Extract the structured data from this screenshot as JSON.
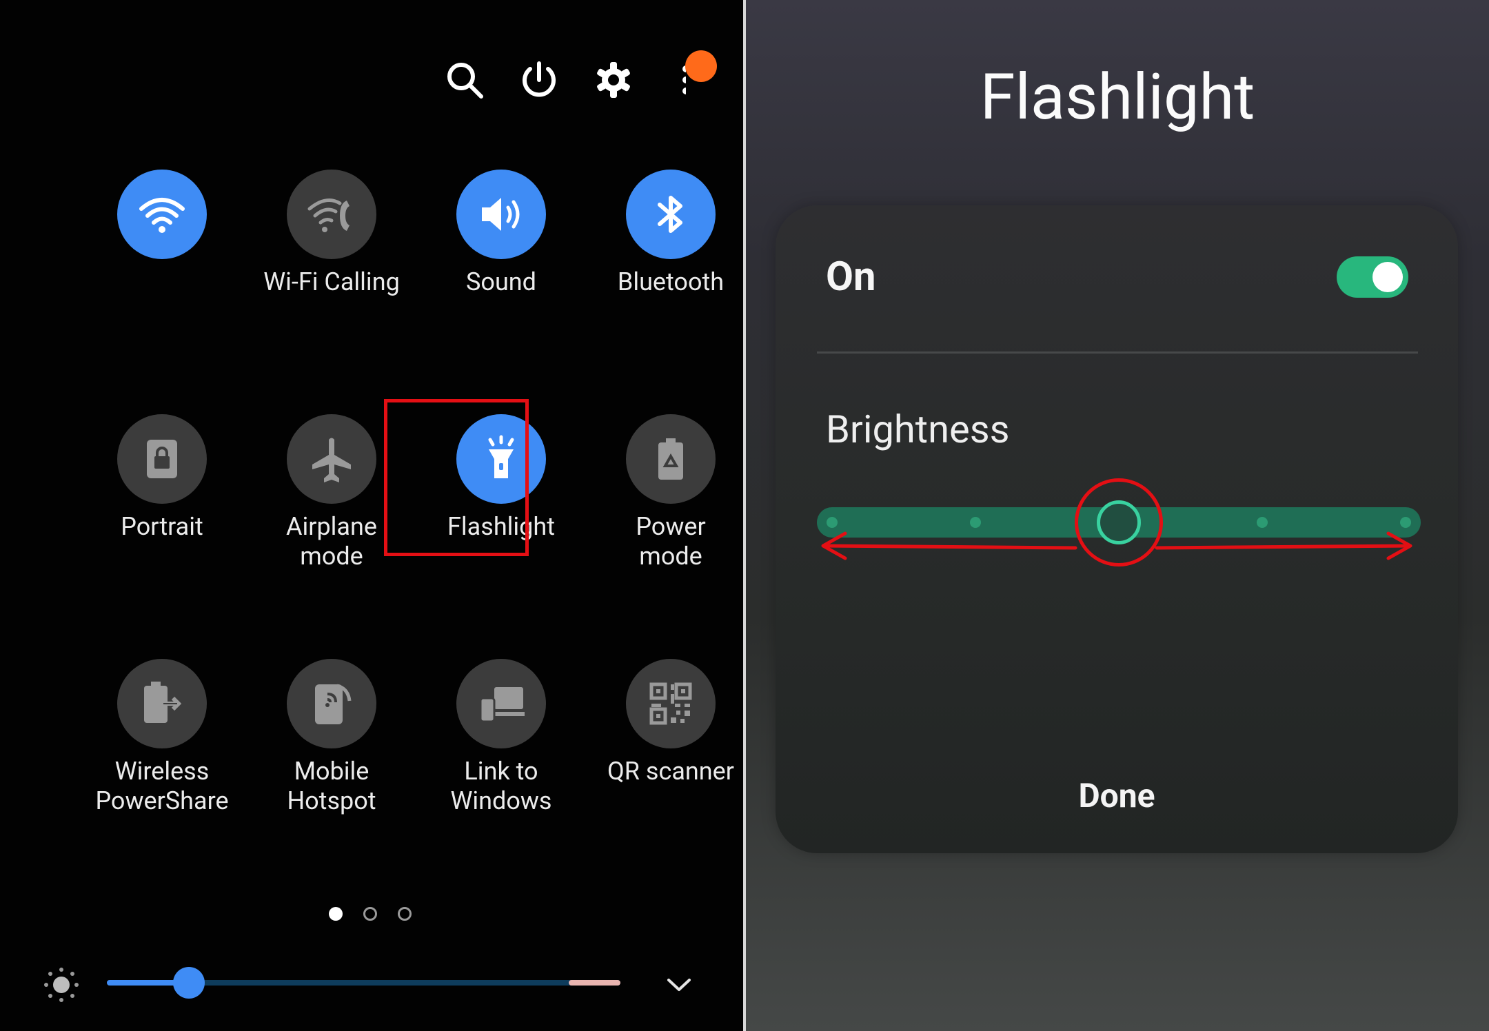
{
  "left_panel": {
    "top_icons": [
      "search-icon",
      "power-icon",
      "settings-icon",
      "more-options-icon"
    ],
    "tiles": [
      {
        "label": "",
        "icon": "wifi-icon",
        "active": true
      },
      {
        "label": "Wi-Fi Calling",
        "icon": "wifi-calling-icon",
        "active": false
      },
      {
        "label": "Sound",
        "icon": "sound-icon",
        "active": true
      },
      {
        "label": "Bluetooth",
        "icon": "bluetooth-icon",
        "active": true
      },
      {
        "label": "Portrait",
        "icon": "portrait-lock-icon",
        "active": false
      },
      {
        "label": "Airplane\nmode",
        "icon": "airplane-icon",
        "active": false
      },
      {
        "label": "Flashlight",
        "icon": "flashlight-icon",
        "active": true
      },
      {
        "label": "Power\nmode",
        "icon": "power-mode-icon",
        "active": false
      },
      {
        "label": "Wireless\nPowerShare",
        "icon": "wireless-powershare-icon",
        "active": false
      },
      {
        "label": "Mobile\nHotspot",
        "icon": "mobile-hotspot-icon",
        "active": false
      },
      {
        "label": "Link to\nWindows",
        "icon": "link-to-windows-icon",
        "active": false
      },
      {
        "label": "QR scanner",
        "icon": "qr-scanner-icon",
        "active": false
      }
    ],
    "page_indicator": {
      "pages": 3,
      "current": 1
    },
    "brightness_slider": {
      "value_fraction": 0.16
    }
  },
  "right_panel": {
    "title": "Flashlight",
    "on_label": "On",
    "toggle_on": true,
    "brightness_label": "Brightness",
    "brightness_levels": 5,
    "brightness_level": 3,
    "done_label": "Done"
  },
  "colors": {
    "active_tile": "#3f8cf5",
    "inactive_tile": "#3c3c3c",
    "highlight": "#e40f14",
    "toggle_on": "#28b77d",
    "slider_green": "#1f6e55"
  }
}
